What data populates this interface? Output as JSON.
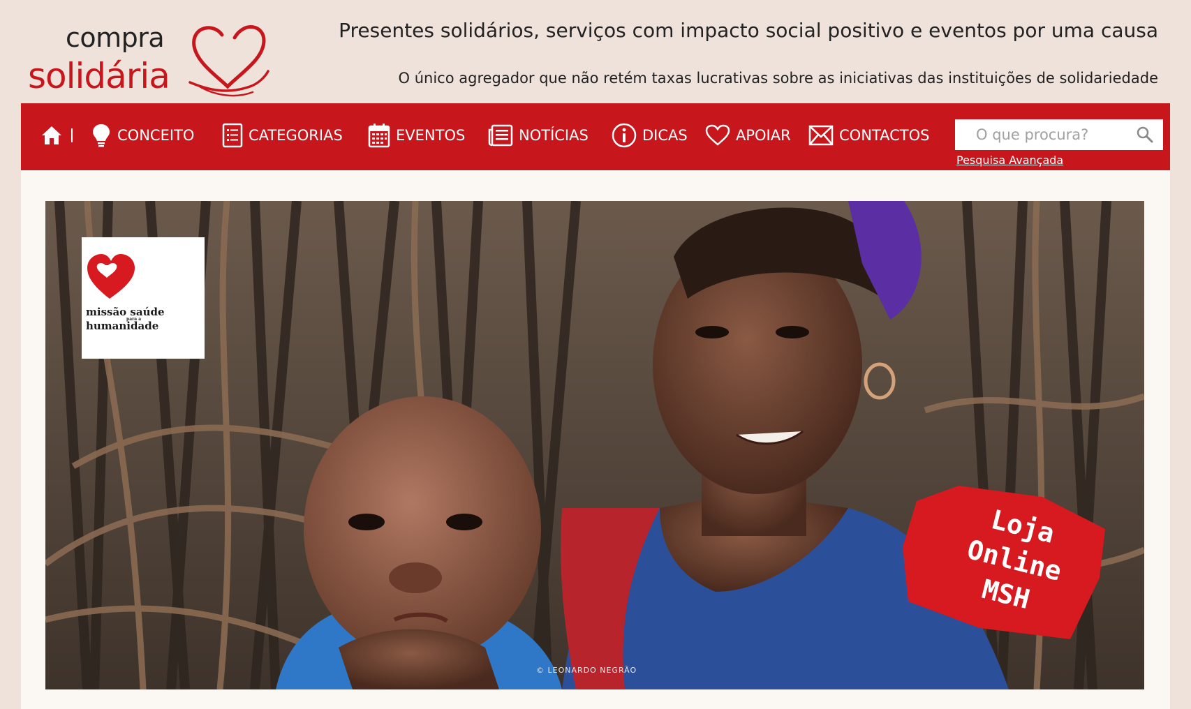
{
  "brand": {
    "logo_word1": "compra",
    "logo_word2": "solidária",
    "accent_color": "#c8161d"
  },
  "header": {
    "tagline": "Presentes solidários, serviços com impacto social positivo e eventos por uma causa",
    "subtagline": "O único agregador que não retém taxas lucrativas sobre as iniciativas das instituições de solidariedade"
  },
  "nav": {
    "home_icon": "home-icon",
    "items": [
      {
        "label": "CONCEITO",
        "icon": "lightbulb-icon"
      },
      {
        "label": "CATEGORIAS",
        "icon": "list-icon"
      },
      {
        "label": "EVENTOS",
        "icon": "calendar-icon"
      },
      {
        "label": "NOTÍCIAS",
        "icon": "newspaper-icon"
      },
      {
        "label": "DICAS",
        "icon": "info-icon"
      },
      {
        "label": "APOIAR",
        "icon": "heart-icon"
      },
      {
        "label": "CONTACTOS",
        "icon": "envelope-icon"
      }
    ],
    "search_placeholder": "O que procura?",
    "advanced_search": "Pesquisa Avançada"
  },
  "hero": {
    "partner_logo_line1": "missão saúde",
    "partner_logo_small": "para a",
    "partner_logo_line2": "humanidade",
    "promo_line1": "Loja",
    "promo_line2": "Online",
    "promo_line3": "MSH",
    "photo_credit": "© LEONARDO NEGRÃO"
  }
}
